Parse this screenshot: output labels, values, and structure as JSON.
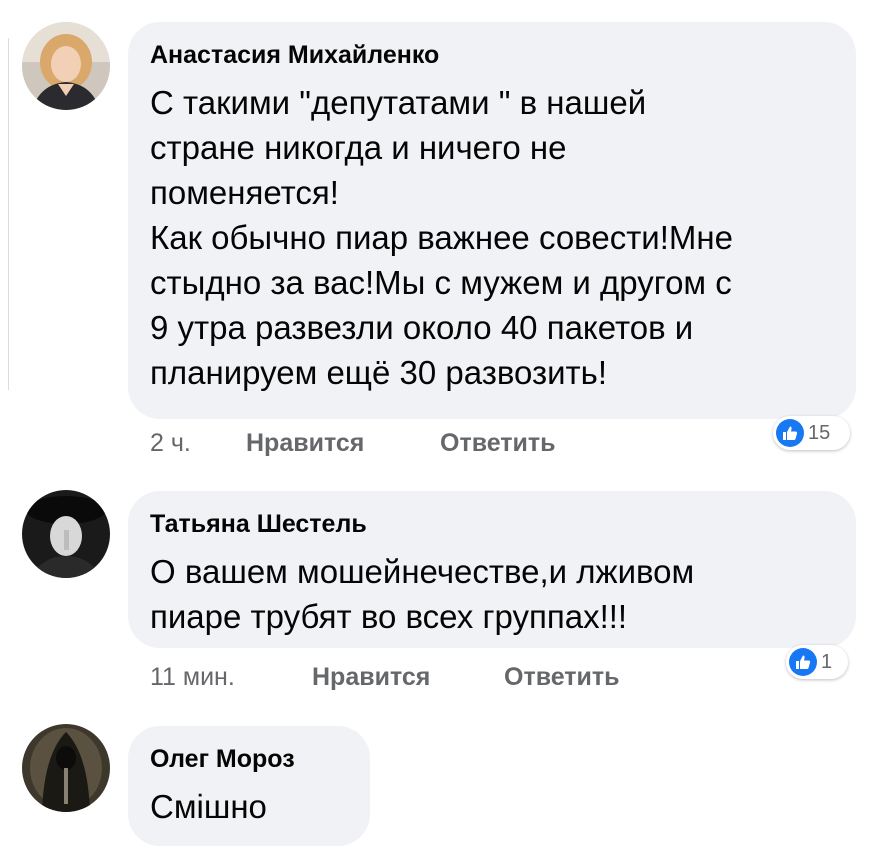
{
  "comments": [
    {
      "author": "Анастасия Михайленко",
      "lines": [
        "С такими \"депутатами \" в нашей",
        "стране никогда и ничего не",
        "поменяется!",
        "Как обычно пиар важнее совести!Мне",
        "стыдно за вас!Мы с мужем и другом с",
        "9 утра развезли около 40 пакетов и",
        "планируем ещё 30 развозить!"
      ],
      "time": "2 ч.",
      "like_label": "Нравится",
      "reply_label": "Ответить",
      "reaction_count": "15",
      "reaction_icon": "thumbs-up-icon"
    },
    {
      "author": "Татьяна Шестель",
      "lines": [
        "О вашем мошейнечестве,и лживом",
        "пиаре трубят во всех группах!!!"
      ],
      "time": "11 мин.",
      "like_label": "Нравится",
      "reply_label": "Ответить",
      "reaction_count": "1",
      "reaction_icon": "thumbs-up-icon"
    },
    {
      "author": "Олег Мороз",
      "lines": [
        "Смішно"
      ]
    }
  ],
  "colors": {
    "bubble": "#f0f2f5",
    "meta_text": "#65676b",
    "like_blue": "#1877f2"
  }
}
